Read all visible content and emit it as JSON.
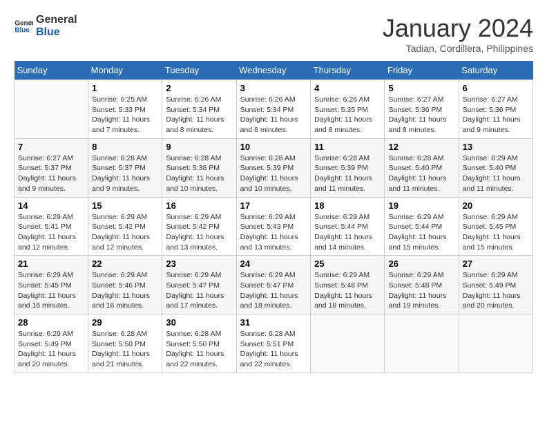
{
  "logo": {
    "line1": "General",
    "line2": "Blue"
  },
  "title": "January 2024",
  "subtitle": "Tadian, Cordillera, Philippines",
  "weekdays": [
    "Sunday",
    "Monday",
    "Tuesday",
    "Wednesday",
    "Thursday",
    "Friday",
    "Saturday"
  ],
  "weeks": [
    [
      {
        "day": "",
        "info": ""
      },
      {
        "day": "1",
        "info": "Sunrise: 6:25 AM\nSunset: 5:33 PM\nDaylight: 11 hours\nand 7 minutes."
      },
      {
        "day": "2",
        "info": "Sunrise: 6:26 AM\nSunset: 5:34 PM\nDaylight: 11 hours\nand 8 minutes."
      },
      {
        "day": "3",
        "info": "Sunrise: 6:26 AM\nSunset: 5:34 PM\nDaylight: 11 hours\nand 8 minutes."
      },
      {
        "day": "4",
        "info": "Sunrise: 6:26 AM\nSunset: 5:35 PM\nDaylight: 11 hours\nand 8 minutes."
      },
      {
        "day": "5",
        "info": "Sunrise: 6:27 AM\nSunset: 5:36 PM\nDaylight: 11 hours\nand 8 minutes."
      },
      {
        "day": "6",
        "info": "Sunrise: 6:27 AM\nSunset: 5:36 PM\nDaylight: 11 hours\nand 9 minutes."
      }
    ],
    [
      {
        "day": "7",
        "info": "Sunrise: 6:27 AM\nSunset: 5:37 PM\nDaylight: 11 hours\nand 9 minutes."
      },
      {
        "day": "8",
        "info": "Sunrise: 6:28 AM\nSunset: 5:37 PM\nDaylight: 11 hours\nand 9 minutes."
      },
      {
        "day": "9",
        "info": "Sunrise: 6:28 AM\nSunset: 5:38 PM\nDaylight: 11 hours\nand 10 minutes."
      },
      {
        "day": "10",
        "info": "Sunrise: 6:28 AM\nSunset: 5:39 PM\nDaylight: 11 hours\nand 10 minutes."
      },
      {
        "day": "11",
        "info": "Sunrise: 6:28 AM\nSunset: 5:39 PM\nDaylight: 11 hours\nand 11 minutes."
      },
      {
        "day": "12",
        "info": "Sunrise: 6:28 AM\nSunset: 5:40 PM\nDaylight: 11 hours\nand 11 minutes."
      },
      {
        "day": "13",
        "info": "Sunrise: 6:29 AM\nSunset: 5:40 PM\nDaylight: 11 hours\nand 11 minutes."
      }
    ],
    [
      {
        "day": "14",
        "info": "Sunrise: 6:29 AM\nSunset: 5:41 PM\nDaylight: 11 hours\nand 12 minutes."
      },
      {
        "day": "15",
        "info": "Sunrise: 6:29 AM\nSunset: 5:42 PM\nDaylight: 11 hours\nand 12 minutes."
      },
      {
        "day": "16",
        "info": "Sunrise: 6:29 AM\nSunset: 5:42 PM\nDaylight: 11 hours\nand 13 minutes."
      },
      {
        "day": "17",
        "info": "Sunrise: 6:29 AM\nSunset: 5:43 PM\nDaylight: 11 hours\nand 13 minutes."
      },
      {
        "day": "18",
        "info": "Sunrise: 6:29 AM\nSunset: 5:44 PM\nDaylight: 11 hours\nand 14 minutes."
      },
      {
        "day": "19",
        "info": "Sunrise: 6:29 AM\nSunset: 5:44 PM\nDaylight: 11 hours\nand 15 minutes."
      },
      {
        "day": "20",
        "info": "Sunrise: 6:29 AM\nSunset: 5:45 PM\nDaylight: 11 hours\nand 15 minutes."
      }
    ],
    [
      {
        "day": "21",
        "info": "Sunrise: 6:29 AM\nSunset: 5:45 PM\nDaylight: 11 hours\nand 16 minutes."
      },
      {
        "day": "22",
        "info": "Sunrise: 6:29 AM\nSunset: 5:46 PM\nDaylight: 11 hours\nand 16 minutes."
      },
      {
        "day": "23",
        "info": "Sunrise: 6:29 AM\nSunset: 5:47 PM\nDaylight: 11 hours\nand 17 minutes."
      },
      {
        "day": "24",
        "info": "Sunrise: 6:29 AM\nSunset: 5:47 PM\nDaylight: 11 hours\nand 18 minutes."
      },
      {
        "day": "25",
        "info": "Sunrise: 6:29 AM\nSunset: 5:48 PM\nDaylight: 11 hours\nand 18 minutes."
      },
      {
        "day": "26",
        "info": "Sunrise: 6:29 AM\nSunset: 5:48 PM\nDaylight: 11 hours\nand 19 minutes."
      },
      {
        "day": "27",
        "info": "Sunrise: 6:29 AM\nSunset: 5:49 PM\nDaylight: 11 hours\nand 20 minutes."
      }
    ],
    [
      {
        "day": "28",
        "info": "Sunrise: 6:29 AM\nSunset: 5:49 PM\nDaylight: 11 hours\nand 20 minutes."
      },
      {
        "day": "29",
        "info": "Sunrise: 6:28 AM\nSunset: 5:50 PM\nDaylight: 11 hours\nand 21 minutes."
      },
      {
        "day": "30",
        "info": "Sunrise: 6:28 AM\nSunset: 5:50 PM\nDaylight: 11 hours\nand 22 minutes."
      },
      {
        "day": "31",
        "info": "Sunrise: 6:28 AM\nSunset: 5:51 PM\nDaylight: 11 hours\nand 22 minutes."
      },
      {
        "day": "",
        "info": ""
      },
      {
        "day": "",
        "info": ""
      },
      {
        "day": "",
        "info": ""
      }
    ]
  ]
}
